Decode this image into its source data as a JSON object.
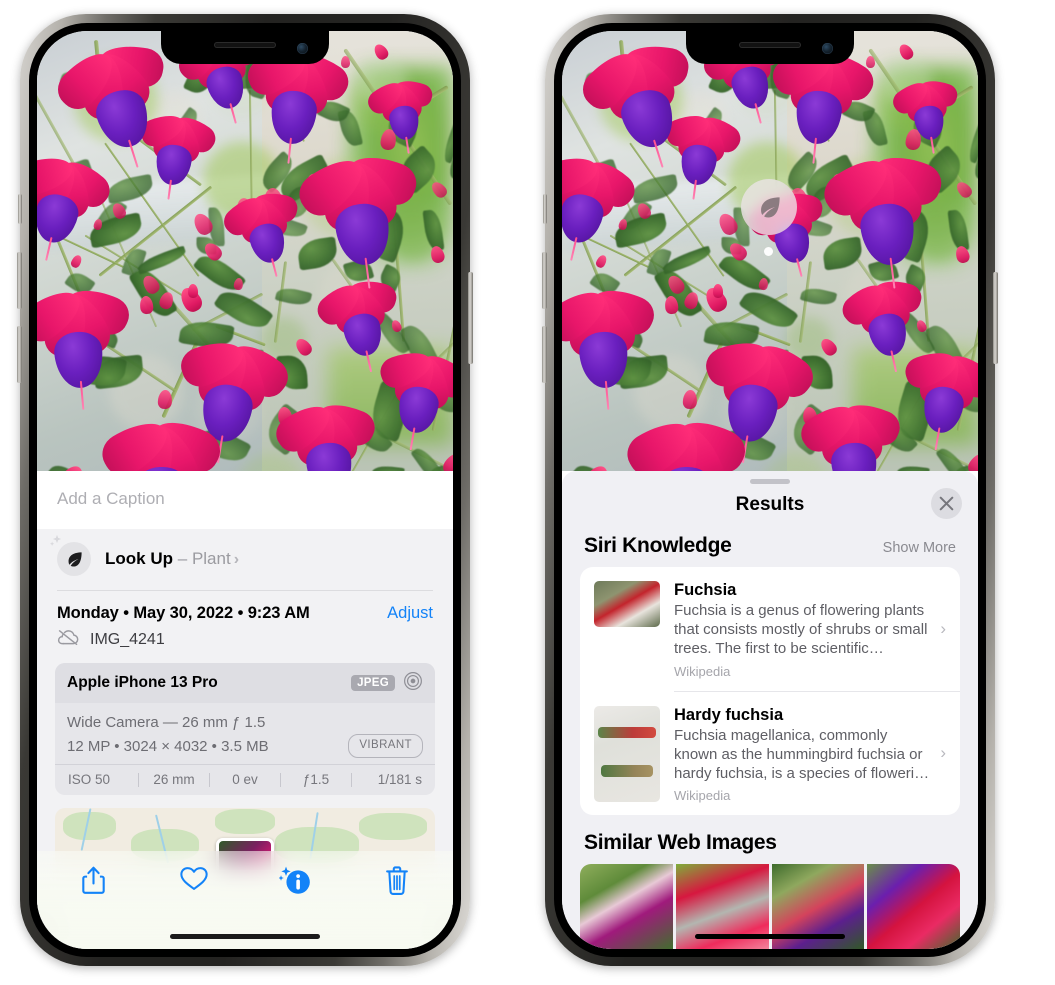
{
  "left_phone": {
    "name": "iphone-photos-info",
    "caption": {
      "placeholder": "Add a Caption"
    },
    "lookup": {
      "label": "Look Up",
      "dash": "–",
      "subject": "Plant",
      "chevron": "›",
      "icon": "leaf-icon"
    },
    "date": {
      "weekday": "Monday",
      "date": "May 30, 2022",
      "time": "9:23 AM",
      "full": "Monday • May 30, 2022 • 9:23 AM"
    },
    "adjust_label": "Adjust",
    "filename": "IMG_4241",
    "cloud_icon": "cloud-slash-icon",
    "metadata": {
      "device": "Apple iPhone 13 Pro",
      "format_badge": "JPEG",
      "aperture_icon": "aperture-icon",
      "lens_line": "Wide Camera — 26 mm ƒ 1.5",
      "specs_line": "12 MP • 3024 × 4032 • 3.5 MB",
      "style_pill": "VIBRANT",
      "exif": [
        "ISO 50",
        "26 mm",
        "0 ev",
        "ƒ1.5",
        "1/181 s"
      ]
    },
    "toolbar": [
      {
        "name": "share-button",
        "icon": "share-icon"
      },
      {
        "name": "favorite-button",
        "icon": "heart-icon"
      },
      {
        "name": "info-button",
        "icon": "info-sparkle-icon"
      },
      {
        "name": "delete-button",
        "icon": "trash-icon"
      }
    ],
    "accent_color": "#1383f8"
  },
  "right_phone": {
    "name": "iphone-visual-lookup-results",
    "leaf_badge": {
      "icon": "leaf-icon"
    },
    "sheet": {
      "title": "Results",
      "close_icon": "close-icon",
      "siri_section": {
        "heading": "Siri Knowledge",
        "show_more": "Show More"
      },
      "knowledge_items": [
        {
          "title": "Fuchsia",
          "description": "Fuchsia is a genus of flowering plants that consists mostly of shrubs or small trees. The first to be scientific…",
          "source": "Wikipedia",
          "chevron": "›"
        },
        {
          "title": "Hardy fuchsia",
          "description": "Fuchsia magellanica, commonly known as the hummingbird fuchsia or hardy fuchsia, is a species of floweri…",
          "source": "Wikipedia",
          "chevron": "›"
        }
      ],
      "similar_heading": "Similar Web Images",
      "similar_images": [
        "thumb-1",
        "thumb-2",
        "thumb-3",
        "thumb-4"
      ]
    }
  }
}
